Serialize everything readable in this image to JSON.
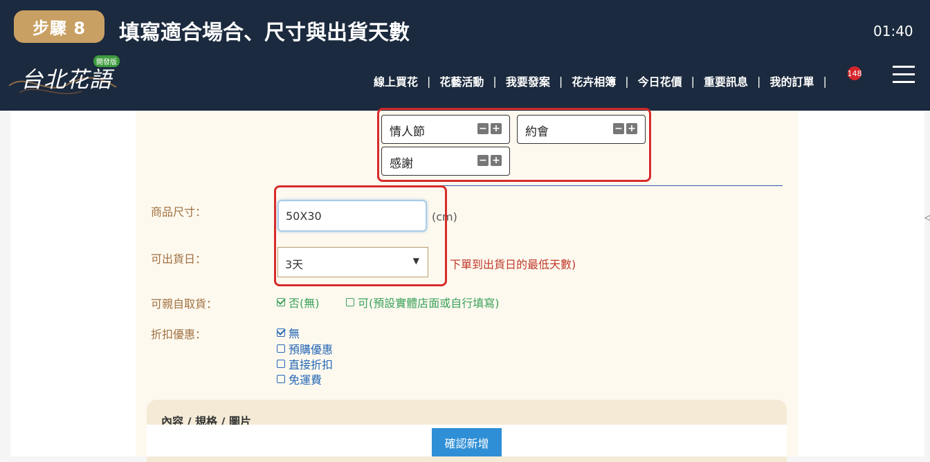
{
  "step": {
    "badge": "步驟 8",
    "title": "填寫適合場合、尺寸與出貨天數",
    "time": "01:40"
  },
  "brand": {
    "logo_text": "台北花語",
    "badge": "開發版"
  },
  "nav": {
    "items": [
      "線上買花",
      "花藝活動",
      "我要發案",
      "花卉相簿",
      "今日花價",
      "重要訊息",
      "我的訂單"
    ],
    "separator": "|",
    "order_count": "148"
  },
  "occasions": [
    {
      "label": "情人節"
    },
    {
      "label": "約會"
    },
    {
      "label": "感謝"
    }
  ],
  "form": {
    "size_label": "商品尺寸：",
    "size_value": "50X30",
    "size_unit": "(cm)",
    "ship_label": "可出貨日：",
    "ship_value": "3天",
    "ship_hint": "下單到出貨日的最低天數)",
    "pickup_label": "可親自取貨：",
    "pickup_options": [
      "否(無)",
      "可(預設實體店面或自行填寫)"
    ],
    "discount_label": "折扣優惠：",
    "discount_options": [
      "無",
      "預購優惠",
      "直接折扣",
      "免運費"
    ]
  },
  "content_section_title": "內容 / 規格 / 圖片",
  "confirm_button": "確認新增",
  "icons": {
    "menu": "hamburger-menu-icon",
    "minus": "minus-icon",
    "plus": "plus-icon",
    "checkbox": "checkbox-icon",
    "caret": "caret-down-icon"
  },
  "colors": {
    "header_bg": "#1b2a3e",
    "badge": "#c9a063",
    "highlight": "#d62b2b",
    "label": "#a07040",
    "button": "#2f8fd6"
  }
}
